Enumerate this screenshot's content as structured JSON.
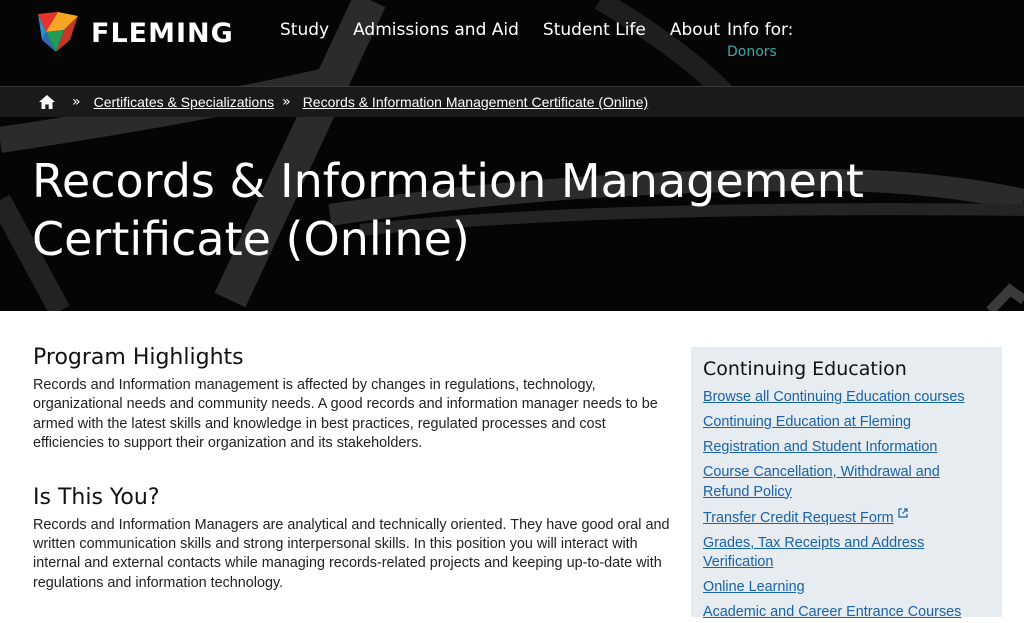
{
  "brand": {
    "name": "FLEMING"
  },
  "nav": {
    "items": [
      {
        "label": "Study"
      },
      {
        "label": "Admissions and Aid"
      },
      {
        "label": "Student Life"
      },
      {
        "label": "About"
      }
    ],
    "info_for": {
      "label": "Info for:",
      "sub": "Donors"
    }
  },
  "breadcrumb": {
    "home_icon": "home-icon",
    "separator": "»",
    "items": [
      {
        "label": "Certificates & Specializations"
      },
      {
        "label": "Records & Information Management Certificate (Online)"
      }
    ]
  },
  "page": {
    "title": "Records & Information Management Certificate (Online)"
  },
  "main": {
    "sections": [
      {
        "heading": "Program Highlights",
        "body": "Records and Information management is affected by changes in regulations, technology, organizational needs and community needs. A good records and information manager needs to be armed with the latest skills and knowledge in best practices, regulated processes and cost efficiencies to support their organization and its stakeholders."
      },
      {
        "heading": "Is This You?",
        "body": "Records and Information Managers are analytical and technically oriented. They have good oral and written communication skills and strong interpersonal skills. In this position you will interact with internal and external contacts while managing records-related projects and keeping up-to-date with regulations and information technology."
      }
    ]
  },
  "sidebar": {
    "heading": "Continuing Education",
    "links": [
      {
        "label": "Browse all Continuing Education courses"
      },
      {
        "label": "Continuing Education at Fleming"
      },
      {
        "label": "Registration and Student Information"
      },
      {
        "label": "Course Cancellation, Withdrawal and Refund Policy"
      },
      {
        "label": "Transfer Credit Request Form",
        "icon": "external-link-icon"
      },
      {
        "label": "Grades, Tax Receipts and Address Verification"
      },
      {
        "label": "Online Learning"
      },
      {
        "label": "Academic and Career Entrance Courses"
      }
    ]
  },
  "colors": {
    "hero_bg": "#050505",
    "accent_teal": "#3fa9a5",
    "link_blue": "#1a63a8",
    "sidebar_bg": "#e6ecef"
  }
}
